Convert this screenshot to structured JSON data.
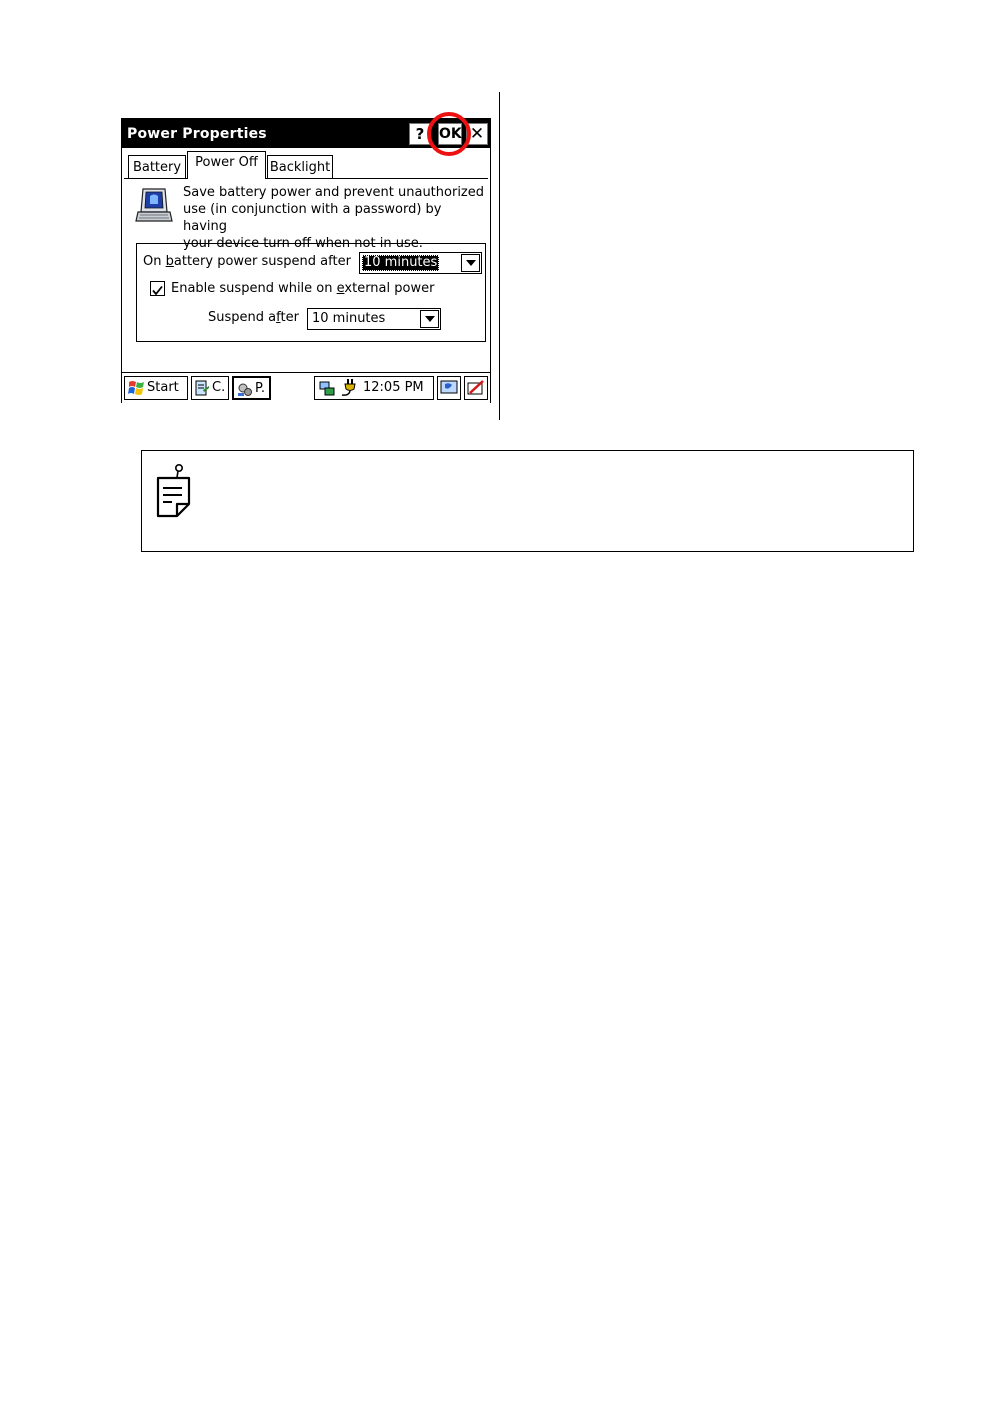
{
  "window": {
    "title": "Power Properties",
    "help_label": "?",
    "ok_label": "OK",
    "close_label": "✕"
  },
  "tabs": [
    {
      "label": "Battery",
      "active": false
    },
    {
      "label": "Power Off",
      "active": true
    },
    {
      "label": "Backlight",
      "active": false
    }
  ],
  "description": {
    "line1": "Save battery power and prevent unauthorized",
    "line2": "use (in conjunction with a password) by having",
    "line3": "your device turn off when not in use."
  },
  "battery_suspend": {
    "label_pre": "On ",
    "label_ul": "b",
    "label_post": "attery power suspend after",
    "value": "10 minutes"
  },
  "external_power": {
    "checked": true,
    "label_pre": "Enable suspend while on ",
    "label_ul": "e",
    "label_post": "xternal power"
  },
  "suspend_after": {
    "label_pre": "Suspend a",
    "label_ul": "f",
    "label_post": "ter",
    "value": "10 minutes"
  },
  "taskbar": {
    "start_label": "Start",
    "task1_label": "C.",
    "task2_label": "P.",
    "clock": "12:05 PM"
  },
  "colors": {
    "highlight": "#e11111",
    "titlebar": "#000000"
  }
}
